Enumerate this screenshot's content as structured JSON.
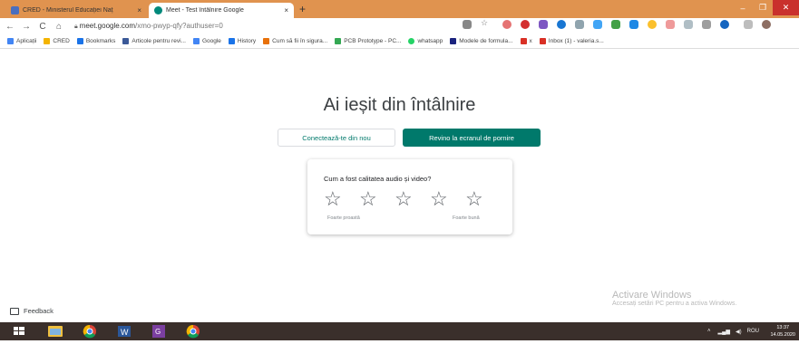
{
  "browser": {
    "tabs": [
      {
        "title": "CRED - Ministerul Educației Naț",
        "close": "×",
        "favicon": "cred-favicon"
      },
      {
        "title": "Meet - Test întâlnire Google",
        "close": "×",
        "favicon": "meet-favicon"
      }
    ],
    "new_tab_label": "+",
    "window_controls": {
      "minimize": "–",
      "maximize": "❐",
      "close": "✕"
    },
    "nav": {
      "back": "←",
      "forward": "→",
      "reload": "C",
      "home": "⌂"
    },
    "url_host": "meet.google.com",
    "url_path": "/xmo-pwyp-qfy?authuser=0",
    "bookmarks": [
      {
        "label": "Aplicații",
        "icon_color": "#4285f4"
      },
      {
        "label": "CRED",
        "icon_color": "#f4b400"
      },
      {
        "label": "Bookmarks",
        "icon_color": "#1a73e8"
      },
      {
        "label": "Articole pentru revi...",
        "icon_color": "#3b5998"
      },
      {
        "label": "Google",
        "icon_color": "#4285f4"
      },
      {
        "label": "History",
        "icon_color": "#1a73e8"
      },
      {
        "label": "Cum să fii în sigura...",
        "icon_color": "#e8710a"
      },
      {
        "label": "PCB Prototype - PC...",
        "icon_color": "#34a853"
      },
      {
        "label": "whatsapp",
        "icon_color": "#25d366"
      },
      {
        "label": "Modele de formula...",
        "icon_color": "#1a237e"
      },
      {
        "label": "x",
        "icon_color": "#d93025"
      },
      {
        "label": "Inbox (1) - valeria.s...",
        "icon_color": "#d93025"
      }
    ]
  },
  "meet": {
    "heading": "Ai ieșit din întâlnire",
    "rejoin_button": "Conectează-te din nou",
    "home_button": "Revino la ecranul de pornire",
    "rating_question": "Cum a fost calitatea audio și video?",
    "rating_low": "Foarte proastă",
    "rating_high": "Foarte bună",
    "star_glyph": "☆",
    "feedback": "Feedback"
  },
  "watermark": {
    "title": "Activare Windows",
    "subtitle": "Accesați setări PC pentru a activa Windows."
  },
  "taskbar": {
    "tray_text": "ROU",
    "time": "13:37",
    "date": "14.05.2020"
  },
  "colors": {
    "tab_strip": "#e0934f",
    "meet_teal": "#00796b",
    "taskbar": "#3a2f2b"
  }
}
